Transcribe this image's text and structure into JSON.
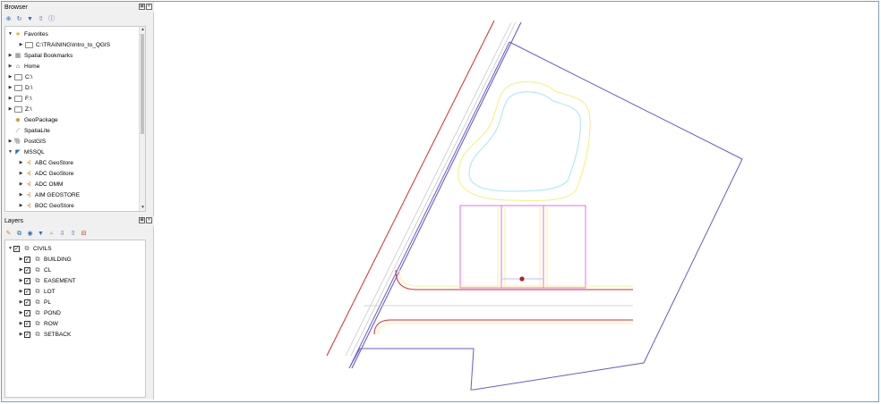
{
  "browser": {
    "title": "Browser",
    "items": [
      {
        "label": "Favorites",
        "level": 0,
        "arrow": "▼",
        "icon": "star-icon"
      },
      {
        "label": "C:\\TRAINING\\Intro_to_QGIS",
        "level": 1,
        "arrow": "▶",
        "icon": "folder-icon"
      },
      {
        "label": "Spatial Bookmarks",
        "level": 0,
        "arrow": "▶",
        "icon": "bookmark-icon"
      },
      {
        "label": "Home",
        "level": 0,
        "arrow": "▶",
        "icon": "home-icon"
      },
      {
        "label": "C:\\",
        "level": 0,
        "arrow": "▶",
        "icon": "folder-icon"
      },
      {
        "label": "D:\\",
        "level": 0,
        "arrow": "▶",
        "icon": "folder-icon"
      },
      {
        "label": "F:\\",
        "level": 0,
        "arrow": "▶",
        "icon": "folder-icon"
      },
      {
        "label": "Z:\\",
        "level": 0,
        "arrow": "▶",
        "icon": "folder-icon"
      },
      {
        "label": "GeoPackage",
        "level": 0,
        "arrow": "",
        "icon": "geopackage-icon"
      },
      {
        "label": "SpatiaLite",
        "level": 0,
        "arrow": "",
        "icon": "spatialite-icon"
      },
      {
        "label": "PostGIS",
        "level": 0,
        "arrow": "▶",
        "icon": "postgis-icon"
      },
      {
        "label": "MSSQL",
        "level": 0,
        "arrow": "▼",
        "icon": "mssql-icon"
      },
      {
        "label": "ABC GeoStore",
        "level": 1,
        "arrow": "▶",
        "icon": "connection-icon"
      },
      {
        "label": "ADC GeoStore",
        "level": 1,
        "arrow": "▶",
        "icon": "connection-icon"
      },
      {
        "label": "ADC OMM",
        "level": 1,
        "arrow": "▶",
        "icon": "connection-icon"
      },
      {
        "label": "AIM GEOSTORE",
        "level": 1,
        "arrow": "▶",
        "icon": "connection-icon"
      },
      {
        "label": "BOC GeoStore",
        "level": 1,
        "arrow": "▶",
        "icon": "connection-icon"
      }
    ]
  },
  "layers": {
    "title": "Layers",
    "group": "CIVILS",
    "items": [
      "BUILDING",
      "CL",
      "EASEMENT",
      "LOT",
      "PL",
      "POND",
      "ROW",
      "SETBACK"
    ]
  },
  "panel_controls": {
    "float": "▣",
    "close": "✕"
  },
  "colors": {
    "row_line": "#d62b2b",
    "property_line": "#6a5acd",
    "pond_inner": "#a8e6f0",
    "pond_outer": "#f5f07a",
    "building": "#e070e0",
    "setback": "#f5f07a",
    "centerline": "#c8c8c8",
    "easement": "#b0c4f0",
    "point": "#b22222"
  }
}
